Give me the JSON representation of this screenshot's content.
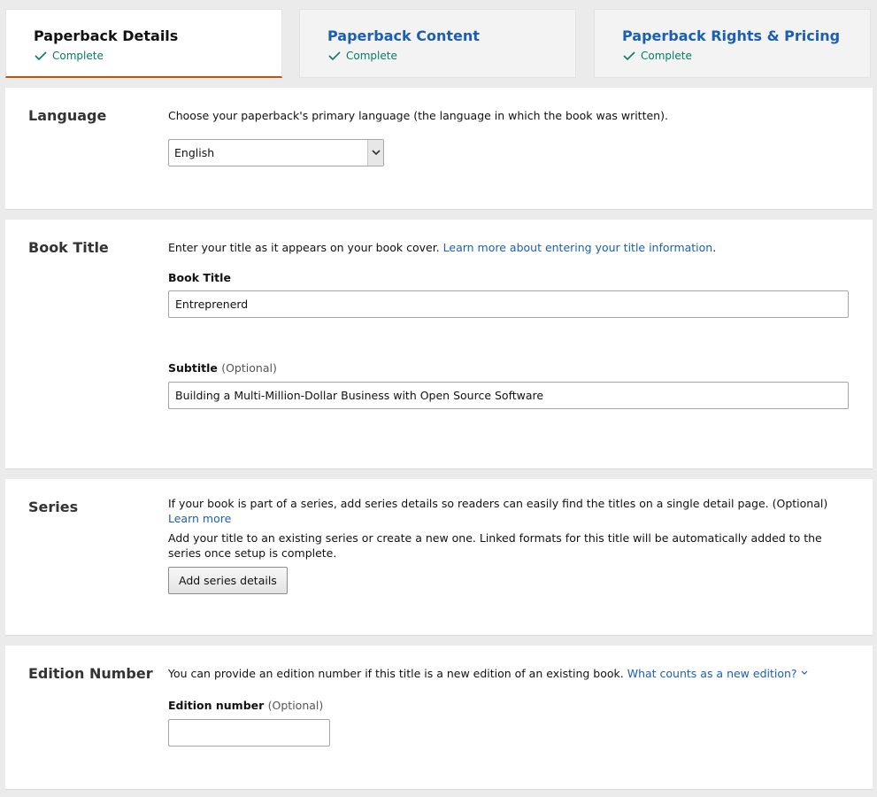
{
  "tabs": [
    {
      "title": "Paperback Details",
      "status": "Complete",
      "active": true
    },
    {
      "title": "Paperback Content",
      "status": "Complete",
      "active": false
    },
    {
      "title": "Paperback Rights & Pricing",
      "status": "Complete",
      "active": false
    }
  ],
  "language": {
    "title": "Language",
    "description": "Choose your paperback's primary language (the language in which the book was written).",
    "selected": "English"
  },
  "book_title": {
    "title": "Book Title",
    "description": "Enter your title as it appears on your book cover.",
    "learn_more_link": "Learn more about entering your title information",
    "description_end": ".",
    "title_label": "Book Title",
    "title_value": "Entreprenerd",
    "subtitle_label": "Subtitle",
    "subtitle_optional": "(Optional)",
    "subtitle_value": "Building a Multi-Million-Dollar Business with Open Source Software"
  },
  "series": {
    "title": "Series",
    "description": "If your book is part of a series, add series details so readers can easily find the titles on a single detail page. (Optional)",
    "learn_more_link": "Learn more",
    "description2": "Add your title to an existing series or create a new one. Linked formats for this title will be automatically added to the series once setup is complete.",
    "button_label": "Add series details"
  },
  "edition": {
    "title": "Edition Number",
    "description": "You can provide an edition number if this title is a new edition of an existing book.",
    "help_link": "What counts as a new edition?",
    "field_label": "Edition number",
    "field_optional": "(Optional)",
    "value": ""
  },
  "colors": {
    "link": "#1a5fb4",
    "success": "#067d62",
    "active_tab_underline": "#c45500"
  }
}
